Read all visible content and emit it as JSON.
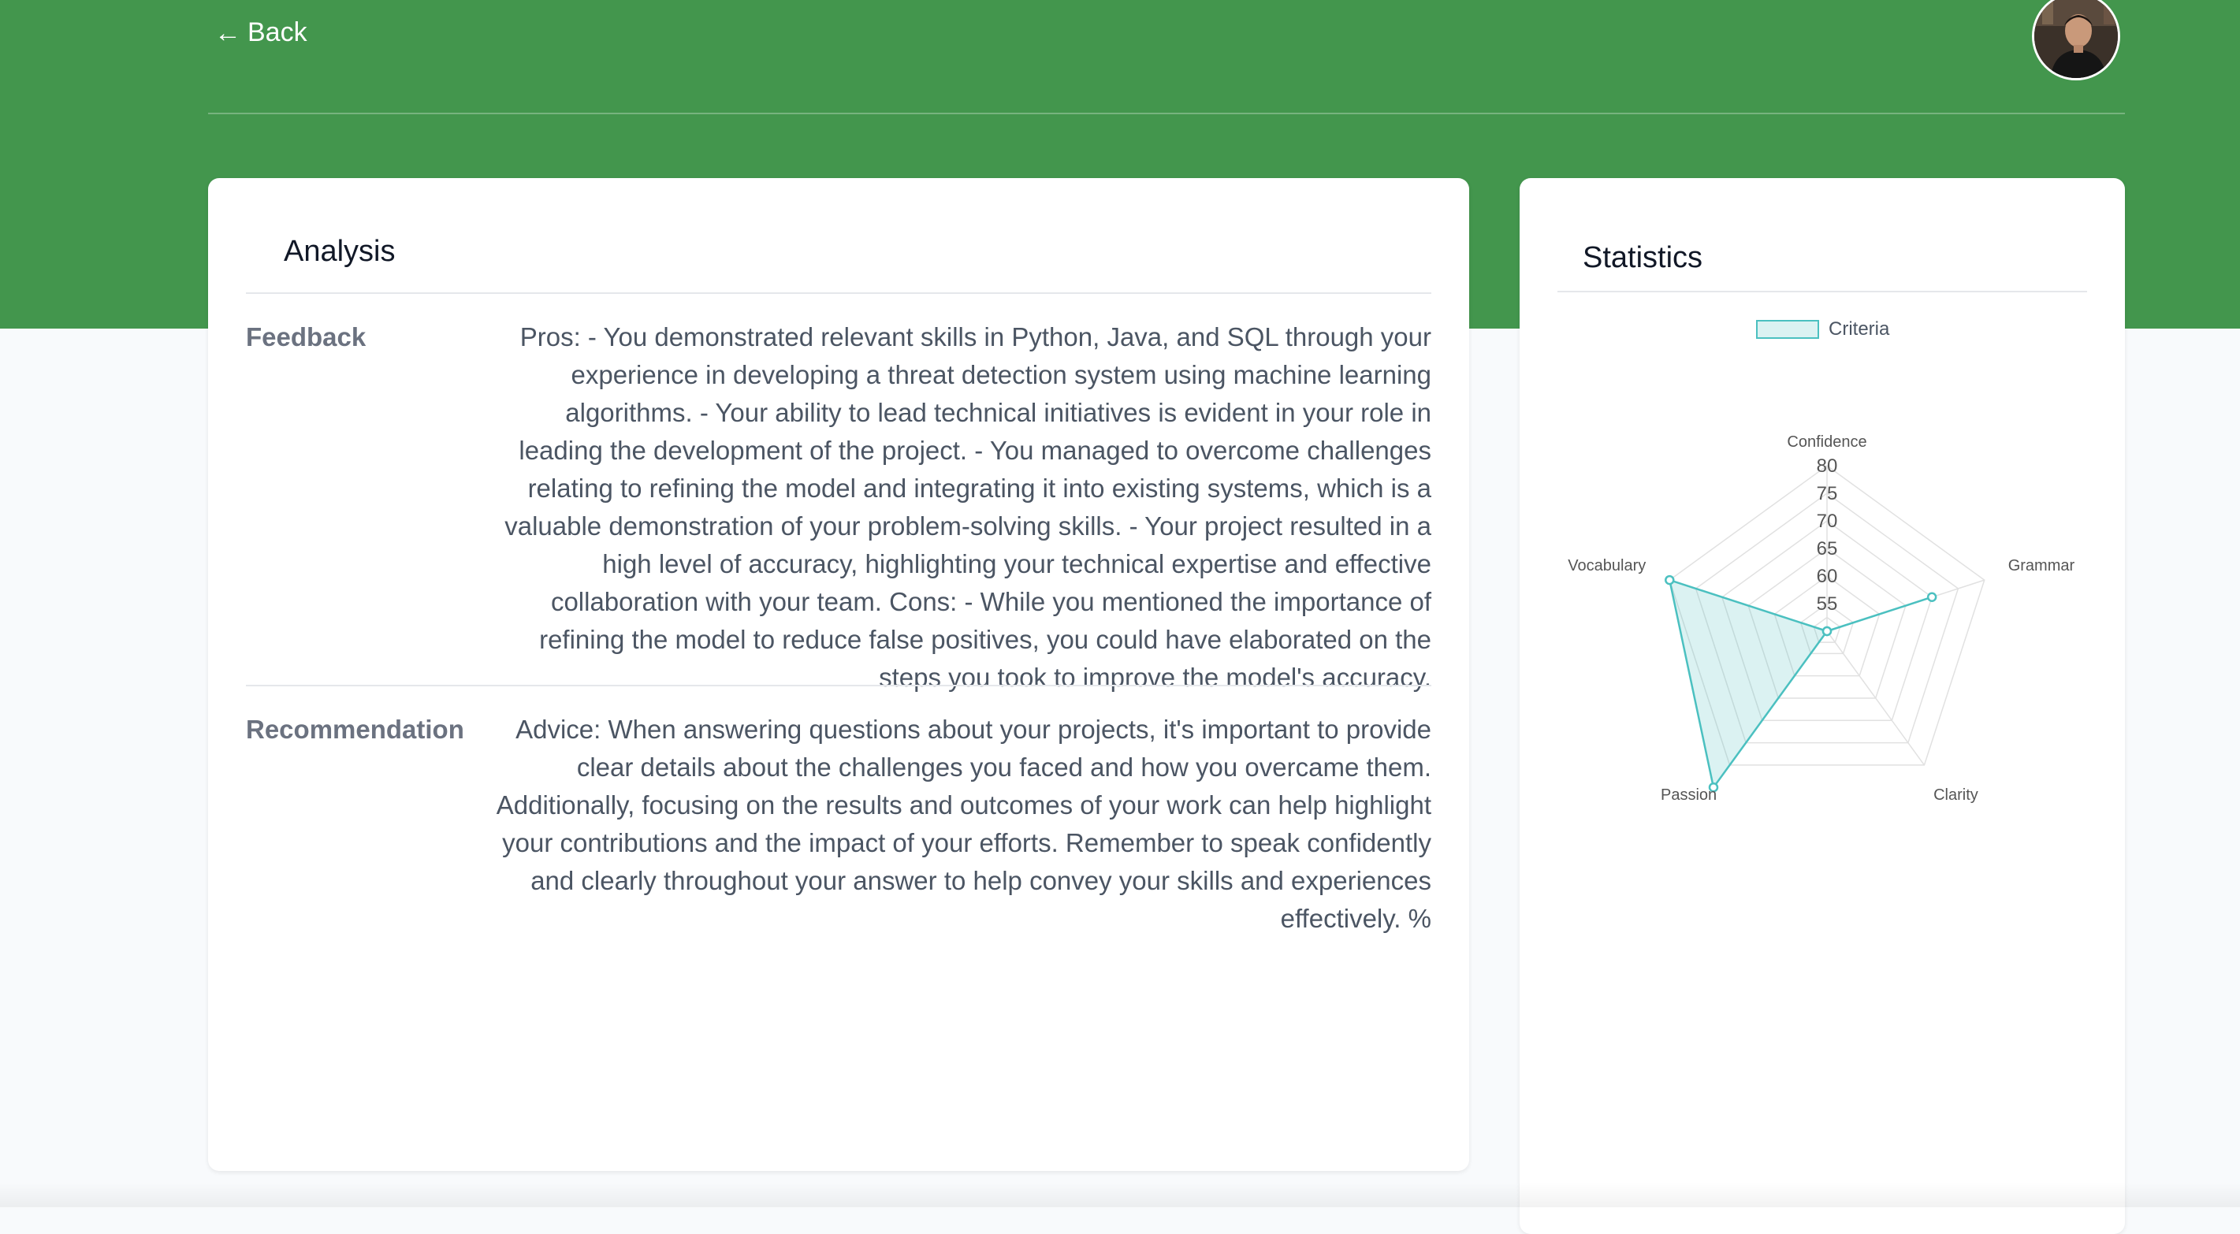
{
  "header": {
    "back_label": "Back",
    "back_icon": "arrow-left-icon",
    "avatar_icon": "user-avatar"
  },
  "analysis": {
    "title": "Analysis",
    "feedback_label": "Feedback",
    "feedback_text": "Pros: - You demonstrated relevant skills in Python, Java, and SQL through your experience in developing a threat detection system using machine learning algorithms. - Your ability to lead technical initiatives is evident in your role in leading the development of the project. - You managed to overcome challenges relating to refining the model and integrating it into existing systems, which is a valuable demonstration of your problem-solving skills. - Your project resulted in a high level of accuracy, highlighting your technical expertise and effective collaboration with your team. Cons: - While you mentioned the importance of refining the model to reduce false positives, you could have elaborated on the steps you took to improve the model's accuracy.",
    "recommendation_label": "Recommendation",
    "recommendation_text": "Advice: When answering questions about your projects, it's important to provide clear details about the challenges you faced and how you overcame them. Additionally, focusing on the results and outcomes of your work can help highlight your contributions and the impact of your efforts. Remember to speak confidently and clearly throughout your answer to help convey your skills and experiences effectively. %"
  },
  "statistics": {
    "title": "Statistics"
  },
  "colors": {
    "header_green": "#43964d",
    "radar_line": "#4bc0c0",
    "radar_fill": "rgba(75,192,192,0.2)"
  },
  "chart_data": {
    "type": "radar",
    "categories": [
      "Confidence",
      "Grammar",
      "Clarity",
      "Passion",
      "Vocabulary"
    ],
    "series": [
      {
        "name": "Criteria",
        "values": [
          50,
          70,
          50,
          85,
          80
        ]
      }
    ],
    "rlim": [
      50,
      80
    ],
    "ticks": [
      55,
      60,
      65,
      70,
      75,
      80
    ],
    "legend": "top"
  }
}
